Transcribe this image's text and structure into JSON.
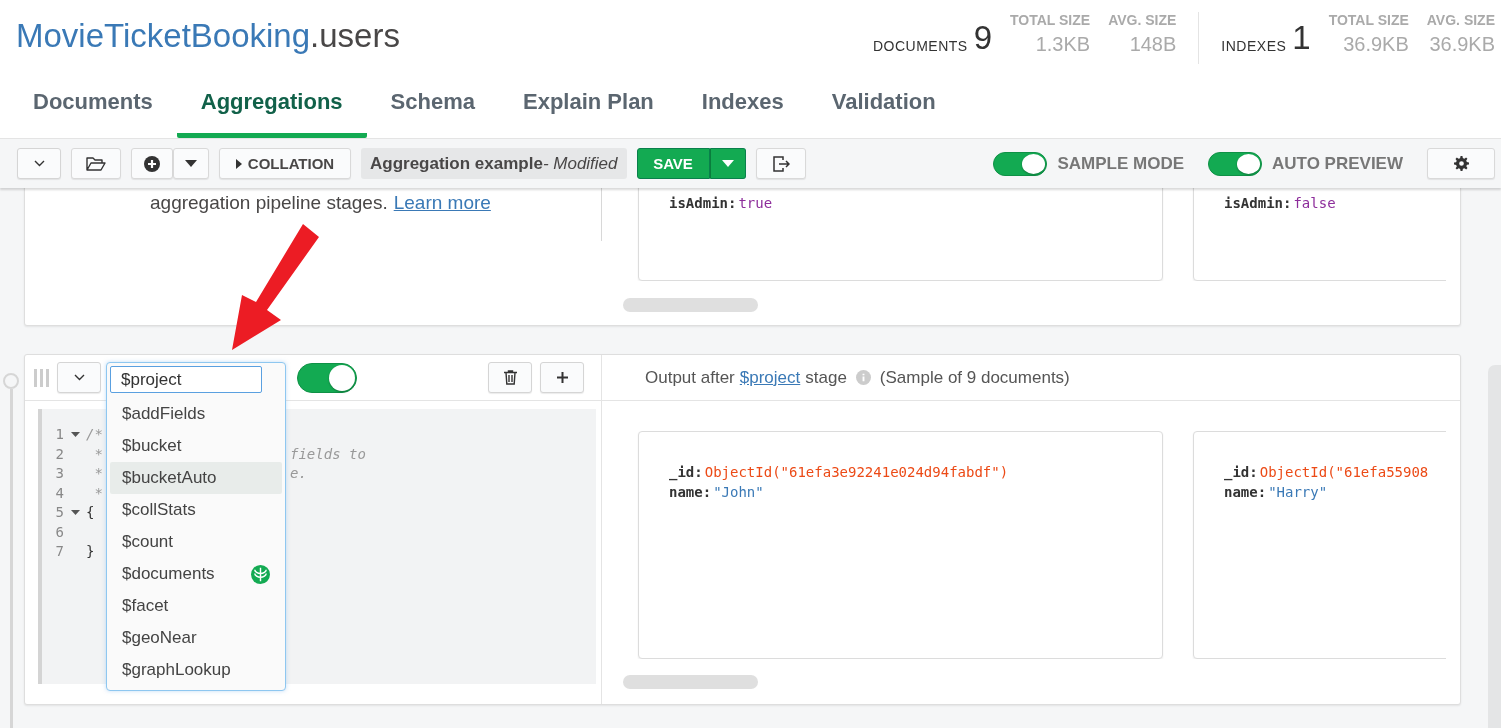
{
  "collection": {
    "database": "MovieTicketBooking",
    "name": ".users"
  },
  "stats": [
    {
      "label": "DOCUMENTS",
      "value": "9",
      "metrics": [
        {
          "label": "TOTAL SIZE",
          "value": "1.3KB"
        },
        {
          "label": "AVG. SIZE",
          "value": "148B"
        }
      ]
    },
    {
      "label": "INDEXES",
      "value": "1",
      "metrics": [
        {
          "label": "TOTAL SIZE",
          "value": "36.9KB"
        },
        {
          "label": "AVG. SIZE",
          "value": "36.9KB"
        }
      ]
    }
  ],
  "tabs": [
    {
      "label": "Documents",
      "selected": false
    },
    {
      "label": "Aggregations",
      "selected": true
    },
    {
      "label": "Schema",
      "selected": false
    },
    {
      "label": "Explain Plan",
      "selected": false
    },
    {
      "label": "Indexes",
      "selected": false
    },
    {
      "label": "Validation",
      "selected": false
    }
  ],
  "toolbar": {
    "collation": "COLLATION",
    "pipeline_name": "Aggregation example",
    "modified": "- Modified",
    "save": "SAVE",
    "toggles": [
      {
        "label": "SAMPLE MODE",
        "on": true
      },
      {
        "label": "AUTO PREVIEW",
        "on": true
      }
    ]
  },
  "stages": [
    {
      "description": "aggregation pipeline stages.",
      "link": "Learn more",
      "documents": [
        [
          {
            "key": "isAdmin:",
            "value": "true",
            "kind": "boolean"
          }
        ],
        [
          {
            "key": "isAdmin:",
            "value": "false",
            "kind": "boolean"
          }
        ]
      ]
    },
    {
      "operator": "$project",
      "enabled": true,
      "output_prefix": "Output after",
      "output_link": "$project",
      "output_suffix": "stage",
      "sample_note": "(Sample of 9 documents)",
      "code_lines": [
        {
          "number": "1",
          "fold": true,
          "text": "/*"
        },
        {
          "number": "2",
          "fold": false,
          "text": " *",
          "tail": "fields to"
        },
        {
          "number": "3",
          "fold": false,
          "text": " *",
          "tail": "e."
        },
        {
          "number": "4",
          "fold": false,
          "text": " *"
        },
        {
          "number": "5",
          "fold": true,
          "text": "{"
        },
        {
          "number": "6",
          "fold": false
        },
        {
          "number": "7",
          "fold": false,
          "text": "}"
        }
      ],
      "dropdown": [
        {
          "label": "$addFields",
          "selected": false,
          "badge": false
        },
        {
          "label": "$bucket",
          "selected": false,
          "badge": false
        },
        {
          "label": "$bucketAuto",
          "selected": true,
          "badge": false
        },
        {
          "label": "$collStats",
          "selected": false,
          "badge": false
        },
        {
          "label": "$count",
          "selected": false,
          "badge": false
        },
        {
          "label": "$documents",
          "selected": false,
          "badge": true
        },
        {
          "label": "$facet",
          "selected": false,
          "badge": false
        },
        {
          "label": "$geoNear",
          "selected": false,
          "badge": false
        },
        {
          "label": "$graphLookup",
          "selected": false,
          "badge": false
        }
      ],
      "documents": [
        [
          {
            "key": "_id:",
            "value": "ObjectId(\"61efa3e92241e024d94fabdf\")",
            "kind": "objectid"
          },
          {
            "key": "name:",
            "value": "\"John\"",
            "kind": "string"
          }
        ],
        [
          {
            "key": "_id:",
            "value": "ObjectId(\"61efa55908",
            "kind": "objectid"
          },
          {
            "key": "name:",
            "value": "\"Harry\"",
            "kind": "string"
          }
        ]
      ]
    }
  ]
}
